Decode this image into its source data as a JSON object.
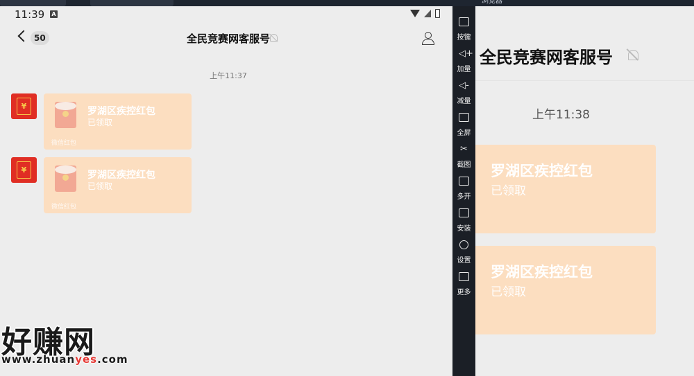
{
  "status_bar": {
    "time": "11:39",
    "badge": "A"
  },
  "chat": {
    "back_count": "50",
    "title": "全民竞赛网客服号",
    "timestamp": "上午11:37",
    "messages": [
      {
        "title": "罗湖区疾控红包",
        "status": "已领取",
        "footer": "微信红包"
      },
      {
        "title": "罗湖区疾控红包",
        "status": "已领取",
        "footer": "微信红包"
      }
    ]
  },
  "toolbar": {
    "items": [
      {
        "icon": "keyboard-icon",
        "label": "按键"
      },
      {
        "icon": "volume-up-icon",
        "label": "加量"
      },
      {
        "icon": "volume-down-icon",
        "label": "减量"
      },
      {
        "icon": "fullscreen-icon",
        "label": "全屏"
      },
      {
        "icon": "scissors-icon",
        "label": "截图"
      },
      {
        "icon": "multi-open-icon",
        "label": "多开"
      },
      {
        "icon": "apk-icon",
        "label": "安装"
      },
      {
        "icon": "settings-icon",
        "label": "设置"
      },
      {
        "icon": "more-icon",
        "label": "更多"
      }
    ]
  },
  "browser": {
    "tab_label": "浏览器",
    "title": "全民竞赛网客服号",
    "timestamp": "上午11:38",
    "messages": [
      {
        "title": "罗湖区疾控红包",
        "status": "已领取"
      },
      {
        "title": "罗湖区疾控红包",
        "status": "已领取"
      }
    ]
  },
  "watermark": {
    "brand": "好赚网",
    "url_prefix": "www.zhuan",
    "url_highlight": "yes",
    "url_suffix": ".com"
  },
  "colors": {
    "bubble": "#fcdec0",
    "avatar": "#e02e24",
    "toolbar": "#1b1f26"
  }
}
